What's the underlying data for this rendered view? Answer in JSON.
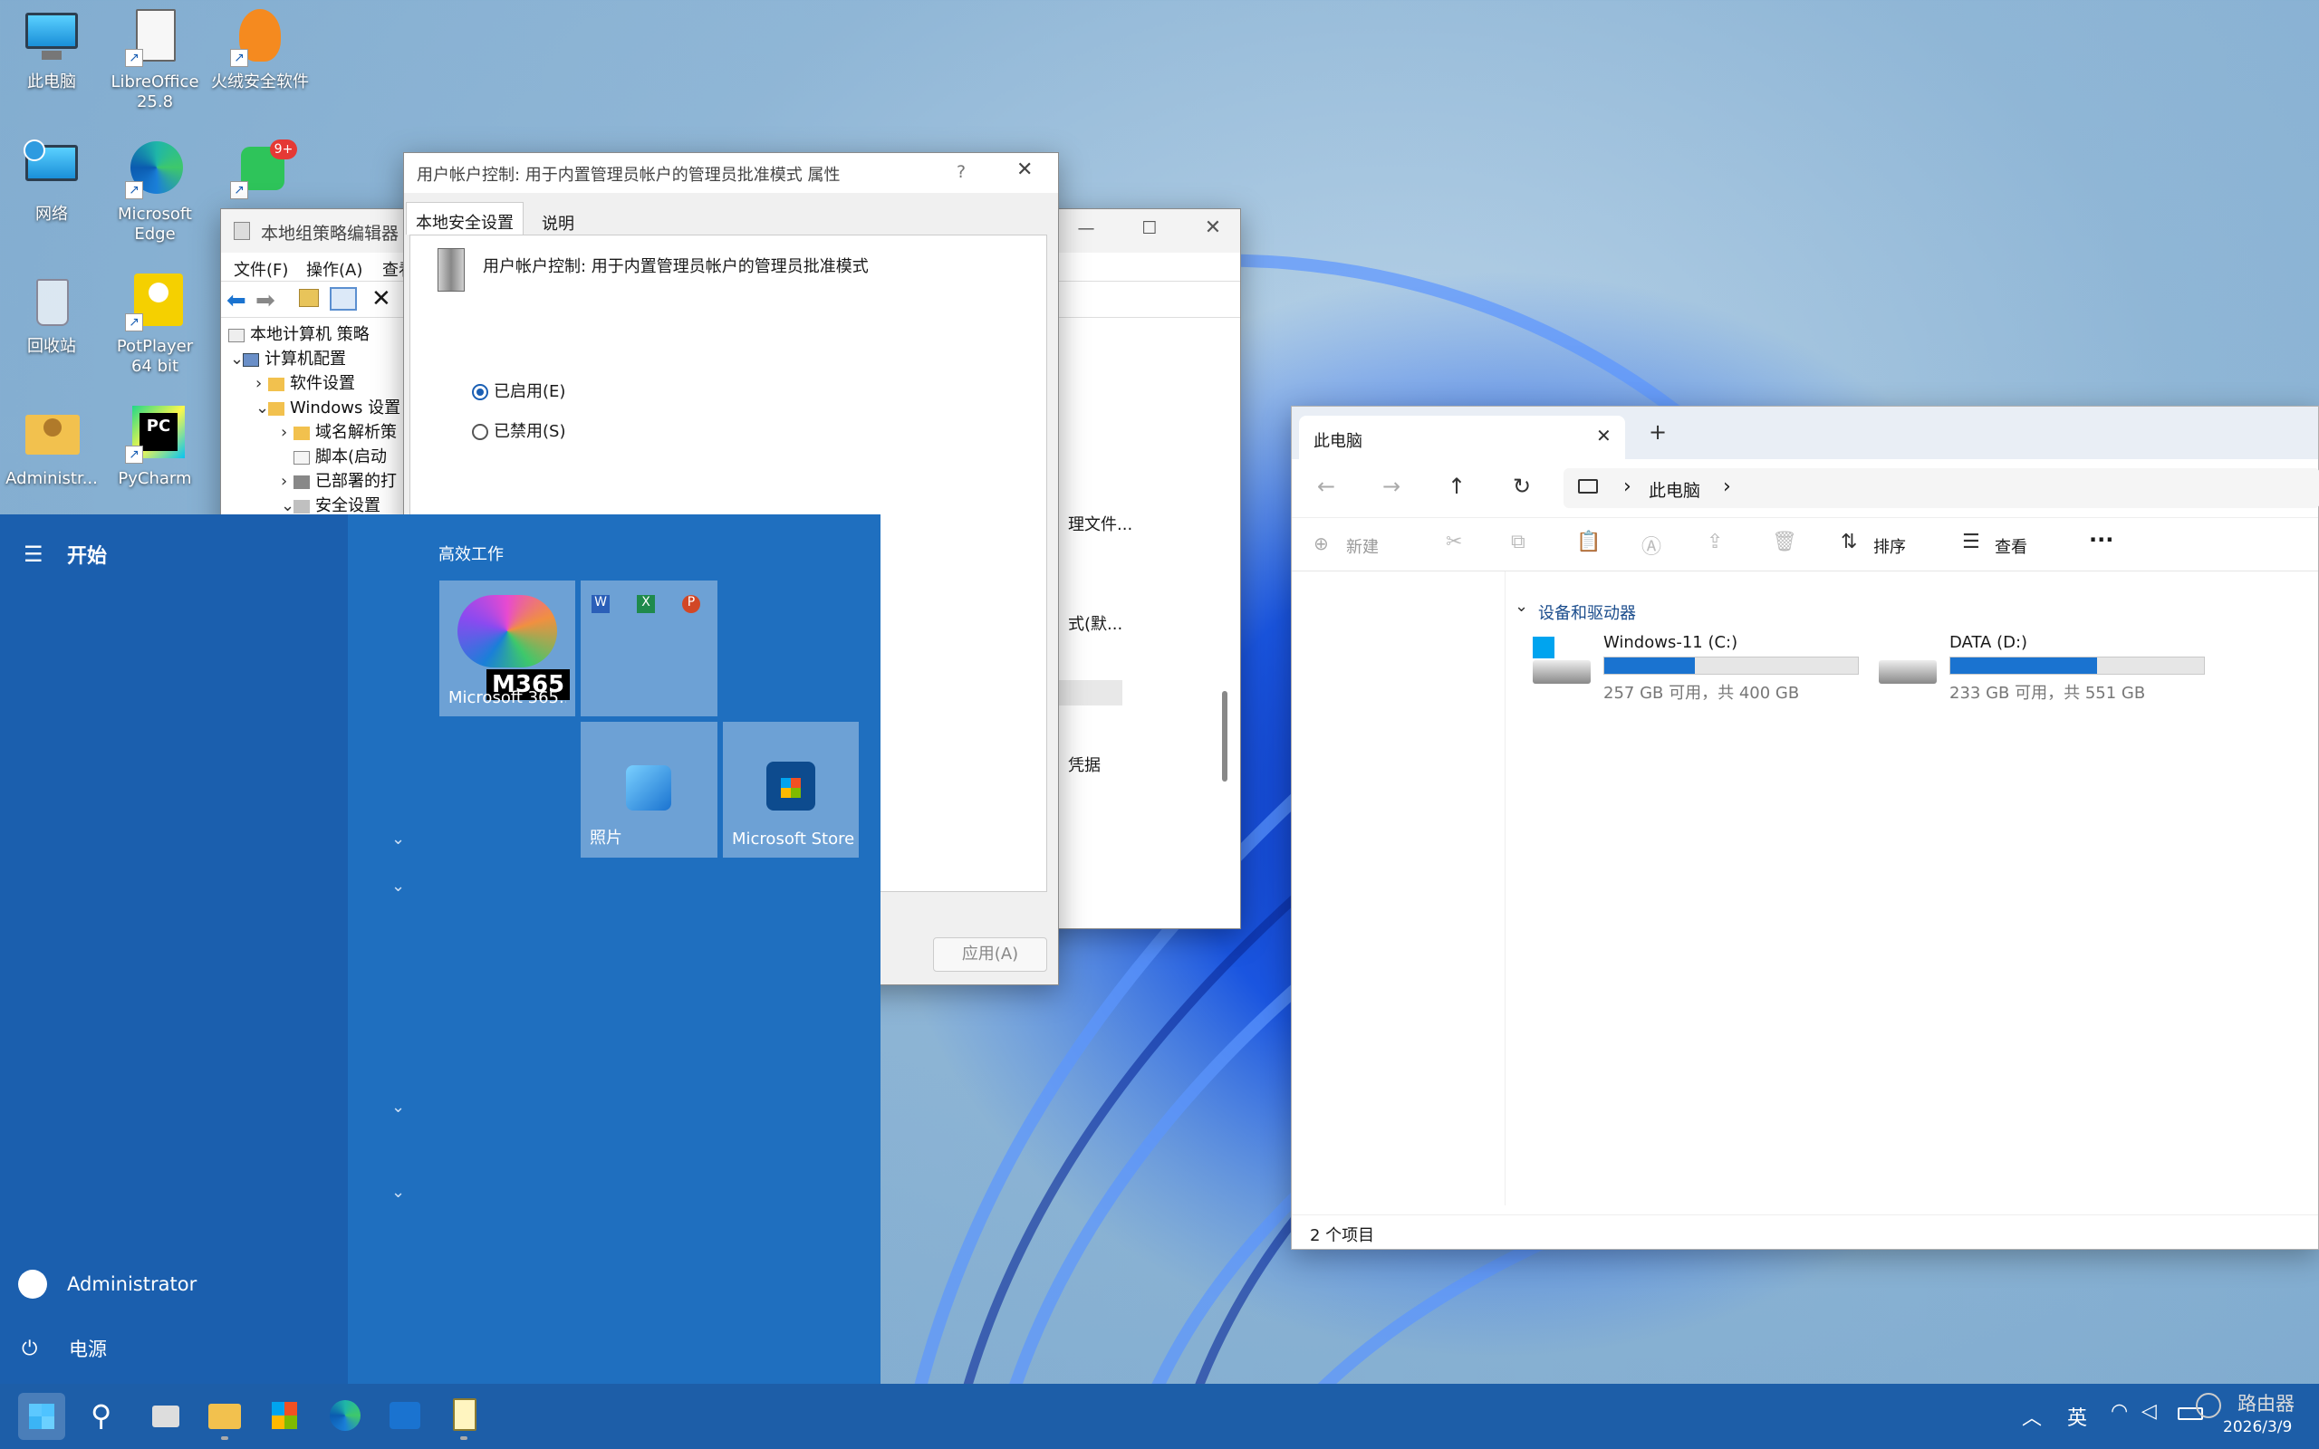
{
  "desktop": {
    "icons": [
      {
        "label": "此电脑",
        "icon": "monitor-icon"
      },
      {
        "label": "LibreOffice 25.8",
        "icon": "libreoffice-icon"
      },
      {
        "label": "火绒安全软件",
        "icon": "huorong-icon"
      },
      {
        "label": "网络",
        "icon": "network-icon"
      },
      {
        "label": "Microsoft Edge",
        "icon": "edge-icon"
      },
      {
        "label": "9+",
        "icon": "wechat-icon"
      },
      {
        "label": "回收站",
        "icon": "recycle-bin-icon"
      },
      {
        "label": "PotPlayer 64 bit",
        "icon": "potplayer-icon"
      },
      {
        "label": "Administr...",
        "icon": "user-folder-icon"
      },
      {
        "label": "PyCharm",
        "icon": "pycharm-icon"
      }
    ]
  },
  "gpedit": {
    "title": "本地组策略编辑器",
    "menu": [
      "文件(F)",
      "操作(A)",
      "查看"
    ],
    "tree": [
      "本地计算机 策略",
      "计算机配置",
      "软件设置",
      "Windows 设置",
      "域名解析策",
      "脚本(启动",
      "已部署的打",
      "安全设置"
    ],
    "right_fragments": [
      "理文件...",
      "式(默...",
      "凭据"
    ]
  },
  "props": {
    "title": "用户帐户控制: 用于内置管理员帐户的管理员批准模式 属性",
    "help": "?",
    "tabs": [
      "本地安全设置",
      "说明"
    ],
    "policy_name": "用户帐户控制: 用于内置管理员帐户的管理员批准模式",
    "options": [
      "已启用(E)",
      "已禁用(S)"
    ],
    "selected": 0,
    "apply_label": "应用(A)"
  },
  "start": {
    "title": "开始",
    "section": "高效工作",
    "tiles": {
      "m365_label": "Microsoft 365...",
      "m365_badge": "M365",
      "photos": "照片",
      "store": "Microsoft Store"
    },
    "user": "Administrator",
    "power": "电源"
  },
  "explorer": {
    "tab_title": "此电脑",
    "new_tab": "+",
    "breadcrumb": "此电脑",
    "toolbar": {
      "new": "新建",
      "sort": "排序",
      "view": "查看",
      "more": "···"
    },
    "group": "设备和驱动器",
    "drives": [
      {
        "name": "Windows-11 (C:)",
        "info": "257 GB 可用，共 400 GB",
        "used_fraction": 0.3575
      },
      {
        "name": "DATA (D:)",
        "info": "233 GB 可用，共 551 GB",
        "used_fraction": 0.577
      }
    ],
    "status": "2 个项目"
  },
  "taskbar": {
    "ime": "英",
    "date": "2026/3/9",
    "watermark": "路由器"
  }
}
